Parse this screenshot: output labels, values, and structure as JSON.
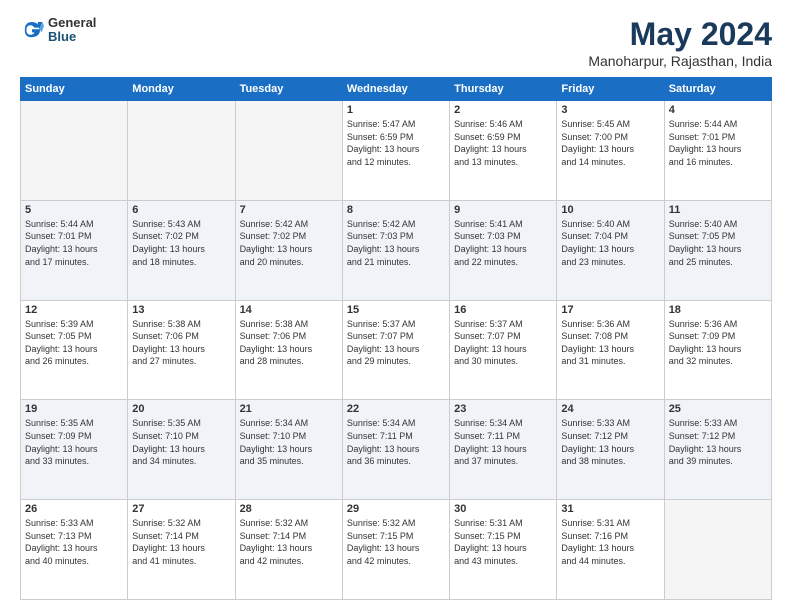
{
  "logo": {
    "general": "General",
    "blue": "Blue"
  },
  "title": "May 2024",
  "location": "Manoharpur, Rajasthan, India",
  "weekdays": [
    "Sunday",
    "Monday",
    "Tuesday",
    "Wednesday",
    "Thursday",
    "Friday",
    "Saturday"
  ],
  "weeks": [
    [
      {
        "day": "",
        "info": ""
      },
      {
        "day": "",
        "info": ""
      },
      {
        "day": "",
        "info": ""
      },
      {
        "day": "1",
        "info": "Sunrise: 5:47 AM\nSunset: 6:59 PM\nDaylight: 13 hours\nand 12 minutes."
      },
      {
        "day": "2",
        "info": "Sunrise: 5:46 AM\nSunset: 6:59 PM\nDaylight: 13 hours\nand 13 minutes."
      },
      {
        "day": "3",
        "info": "Sunrise: 5:45 AM\nSunset: 7:00 PM\nDaylight: 13 hours\nand 14 minutes."
      },
      {
        "day": "4",
        "info": "Sunrise: 5:44 AM\nSunset: 7:01 PM\nDaylight: 13 hours\nand 16 minutes."
      }
    ],
    [
      {
        "day": "5",
        "info": "Sunrise: 5:44 AM\nSunset: 7:01 PM\nDaylight: 13 hours\nand 17 minutes."
      },
      {
        "day": "6",
        "info": "Sunrise: 5:43 AM\nSunset: 7:02 PM\nDaylight: 13 hours\nand 18 minutes."
      },
      {
        "day": "7",
        "info": "Sunrise: 5:42 AM\nSunset: 7:02 PM\nDaylight: 13 hours\nand 20 minutes."
      },
      {
        "day": "8",
        "info": "Sunrise: 5:42 AM\nSunset: 7:03 PM\nDaylight: 13 hours\nand 21 minutes."
      },
      {
        "day": "9",
        "info": "Sunrise: 5:41 AM\nSunset: 7:03 PM\nDaylight: 13 hours\nand 22 minutes."
      },
      {
        "day": "10",
        "info": "Sunrise: 5:40 AM\nSunset: 7:04 PM\nDaylight: 13 hours\nand 23 minutes."
      },
      {
        "day": "11",
        "info": "Sunrise: 5:40 AM\nSunset: 7:05 PM\nDaylight: 13 hours\nand 25 minutes."
      }
    ],
    [
      {
        "day": "12",
        "info": "Sunrise: 5:39 AM\nSunset: 7:05 PM\nDaylight: 13 hours\nand 26 minutes."
      },
      {
        "day": "13",
        "info": "Sunrise: 5:38 AM\nSunset: 7:06 PM\nDaylight: 13 hours\nand 27 minutes."
      },
      {
        "day": "14",
        "info": "Sunrise: 5:38 AM\nSunset: 7:06 PM\nDaylight: 13 hours\nand 28 minutes."
      },
      {
        "day": "15",
        "info": "Sunrise: 5:37 AM\nSunset: 7:07 PM\nDaylight: 13 hours\nand 29 minutes."
      },
      {
        "day": "16",
        "info": "Sunrise: 5:37 AM\nSunset: 7:07 PM\nDaylight: 13 hours\nand 30 minutes."
      },
      {
        "day": "17",
        "info": "Sunrise: 5:36 AM\nSunset: 7:08 PM\nDaylight: 13 hours\nand 31 minutes."
      },
      {
        "day": "18",
        "info": "Sunrise: 5:36 AM\nSunset: 7:09 PM\nDaylight: 13 hours\nand 32 minutes."
      }
    ],
    [
      {
        "day": "19",
        "info": "Sunrise: 5:35 AM\nSunset: 7:09 PM\nDaylight: 13 hours\nand 33 minutes."
      },
      {
        "day": "20",
        "info": "Sunrise: 5:35 AM\nSunset: 7:10 PM\nDaylight: 13 hours\nand 34 minutes."
      },
      {
        "day": "21",
        "info": "Sunrise: 5:34 AM\nSunset: 7:10 PM\nDaylight: 13 hours\nand 35 minutes."
      },
      {
        "day": "22",
        "info": "Sunrise: 5:34 AM\nSunset: 7:11 PM\nDaylight: 13 hours\nand 36 minutes."
      },
      {
        "day": "23",
        "info": "Sunrise: 5:34 AM\nSunset: 7:11 PM\nDaylight: 13 hours\nand 37 minutes."
      },
      {
        "day": "24",
        "info": "Sunrise: 5:33 AM\nSunset: 7:12 PM\nDaylight: 13 hours\nand 38 minutes."
      },
      {
        "day": "25",
        "info": "Sunrise: 5:33 AM\nSunset: 7:12 PM\nDaylight: 13 hours\nand 39 minutes."
      }
    ],
    [
      {
        "day": "26",
        "info": "Sunrise: 5:33 AM\nSunset: 7:13 PM\nDaylight: 13 hours\nand 40 minutes."
      },
      {
        "day": "27",
        "info": "Sunrise: 5:32 AM\nSunset: 7:14 PM\nDaylight: 13 hours\nand 41 minutes."
      },
      {
        "day": "28",
        "info": "Sunrise: 5:32 AM\nSunset: 7:14 PM\nDaylight: 13 hours\nand 42 minutes."
      },
      {
        "day": "29",
        "info": "Sunrise: 5:32 AM\nSunset: 7:15 PM\nDaylight: 13 hours\nand 42 minutes."
      },
      {
        "day": "30",
        "info": "Sunrise: 5:31 AM\nSunset: 7:15 PM\nDaylight: 13 hours\nand 43 minutes."
      },
      {
        "day": "31",
        "info": "Sunrise: 5:31 AM\nSunset: 7:16 PM\nDaylight: 13 hours\nand 44 minutes."
      },
      {
        "day": "",
        "info": ""
      }
    ]
  ]
}
